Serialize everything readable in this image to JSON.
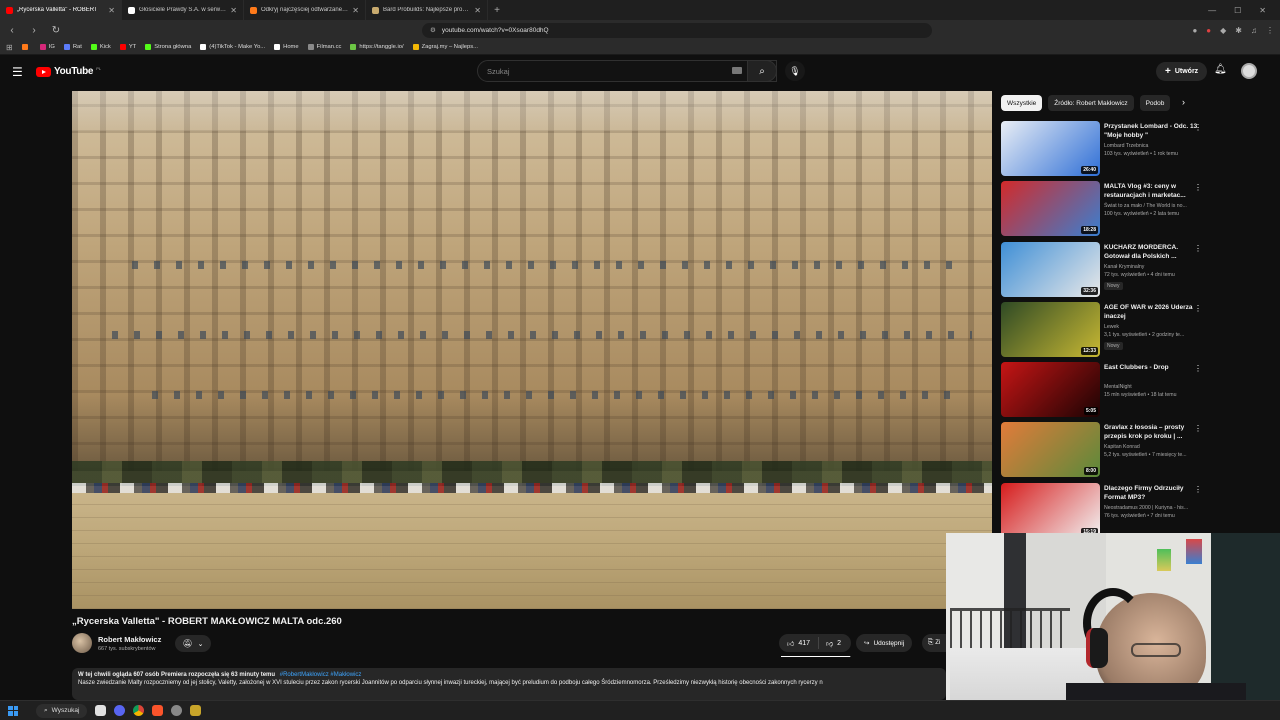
{
  "browser": {
    "tabs": [
      {
        "title": "„Rycerska Valletta\" - ROBERT",
        "active": true,
        "favicon_color": "#ff0000"
      },
      {
        "title": "Głosiciele Prawdy S.A. w serwisie X",
        "active": false,
        "favicon_color": "#ffffff"
      },
      {
        "title": "Odkryj najczęściej odtwarzane utwo",
        "active": false,
        "favicon_color": "#ff7a1a"
      },
      {
        "title": "Bard Probuildś: Najlepsze probuildś",
        "active": false,
        "favicon_color": "#c8aa6e"
      }
    ],
    "new_tab": "+",
    "url": "youtube.com/watch?v=0Xsoar80dhQ",
    "bookmarks": [
      {
        "label": "",
        "color": "#ff7a1a"
      },
      {
        "label": "IG",
        "color": "#d6287a"
      },
      {
        "label": "Rat",
        "color": "#5c7cfa"
      },
      {
        "label": "Kick",
        "color": "#53fc18"
      },
      {
        "label": "YT",
        "color": "#ff0000"
      },
      {
        "label": "Strona główna",
        "color": "#53fc18"
      },
      {
        "label": "(4)TikTok - Make Yo...",
        "color": "#ffffff"
      },
      {
        "label": "Home",
        "color": "#ffffff"
      },
      {
        "label": "Filman.cc",
        "color": "#8a8a8a"
      },
      {
        "label": "https://tanggle.io/",
        "color": "#6cc644"
      },
      {
        "label": "Zagraj.my – Najleps...",
        "color": "#f2b705"
      }
    ]
  },
  "youtube": {
    "logo_text": "YouTube",
    "logo_country": "PL",
    "search_placeholder": "Szukaj",
    "create_label": "Utwórz",
    "chips": [
      {
        "label": "Wszystkie",
        "active": true
      },
      {
        "label": "Źródło: Robert Makłowicz",
        "active": false
      },
      {
        "label": "Podob",
        "active": false
      }
    ],
    "video": {
      "title": "„Rycerska Valletta\" - ROBERT MAKŁOWICZ MALTA odc.260",
      "channel": "Robert Makłowicz",
      "subscribers": "667 tys. subskrybentów",
      "likes": "417",
      "dislikes": "2",
      "like_ratio": 0.99,
      "share_label": "Udostępnij",
      "save_label": "Zi",
      "desc_header": "W tej chwili ogląda 607 osób  Premiera rozpoczęła się 63 minuty temu",
      "desc_tags": "#RobertMakłowicz #Makłowicz",
      "desc_text": "Nasze zwiedzanie Malty rozpoczniemy od jej stolicy, Valetty, założonej w XVI stuleciu przez zakon rycerski Joannitów po odparciu słynnej inwazji tureckiej, mającej być preludium do podboju całego Śródziemnomorza. Prześledzimy niezwykłą historię obecności zakonnych rycerzy n"
    },
    "recommendations": [
      {
        "title": "Przystanek Lombard - Odc. 13. \"Moje hobby \"",
        "channel": "Lombard Trzebnica",
        "meta": "103 tys. wyświetleń • 1 rok temu",
        "duration": "26:40",
        "badge": "",
        "thumb": [
          "#e9eef5",
          "#2f6fd6"
        ]
      },
      {
        "title": "MALTA Vlog #3: ceny w restauracjach i marketac...",
        "channel": "Świat to za mało / The World is no...",
        "meta": "100 tys. wyświetleń • 2 lata temu",
        "duration": "18:28",
        "badge": "",
        "thumb": [
          "#d22a2a",
          "#3a7fd0"
        ]
      },
      {
        "title": "KUCHARZ MORDERCA. Gotował dla Polskich ...",
        "channel": "Kanał Kryminalny",
        "meta": "72 tys. wyświetleń • 4 dni temu",
        "duration": "32:36",
        "badge": "Nowy",
        "thumb": [
          "#3f8fd6",
          "#e8e8e8"
        ]
      },
      {
        "title": "AGE OF WAR w 2026 Uderza inaczej",
        "channel": "Lewek",
        "meta": "3,1 tys. wyświetleń • 2 godziny te...",
        "duration": "12:33",
        "badge": "Nowy",
        "thumb": [
          "#2f4a25",
          "#c8b833"
        ]
      },
      {
        "title": "East Clubbers - Drop",
        "channel": "MentalNight",
        "meta": "15 mln wyświetleń • 18 lat temu",
        "duration": "5:05",
        "badge": "",
        "thumb": [
          "#c61515",
          "#1a0303"
        ]
      },
      {
        "title": "Gravlax z łososia – prosty przepis krok po kroku | ...",
        "channel": "Kapitan Konrad",
        "meta": "5,2 tys. wyświetleń • 7 miesięcy te...",
        "duration": "8:00",
        "badge": "",
        "thumb": [
          "#e27b3a",
          "#5a8a3a"
        ]
      },
      {
        "title": "Dlaczego Firmy Odrzuciły Format MP3?",
        "channel": "Neostradamus 2000 | Kuriyna - his...",
        "meta": "76 tys. wyświetleń • 7 dni temu",
        "duration": "15:19",
        "badge": "",
        "thumb": [
          "#d61c1c",
          "#f2f2f2"
        ]
      }
    ]
  },
  "taskbar": {
    "search_label": "Wyszukaj"
  }
}
